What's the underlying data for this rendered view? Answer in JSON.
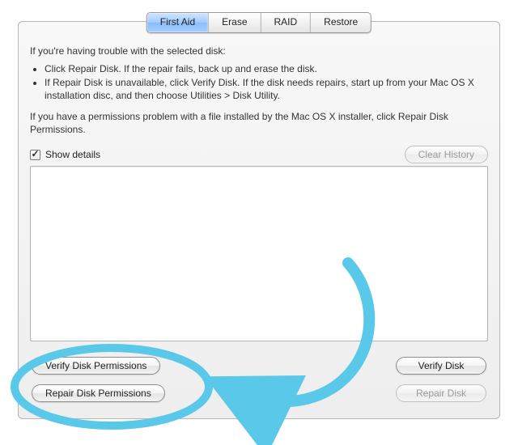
{
  "tabs": {
    "first_aid": "First Aid",
    "erase": "Erase",
    "raid": "RAID",
    "restore": "Restore"
  },
  "intro": {
    "line1": "If you're having trouble with the selected disk:",
    "bullet1": "Click Repair Disk. If the repair fails, back up and erase the disk.",
    "bullet2": "If Repair Disk is unavailable, click Verify Disk. If the disk needs repairs, start up from your Mac OS X installation disc, and then choose Utilities > Disk Utility.",
    "line2": "If you have a permissions problem with a file installed by the Mac OS X installer, click Repair Disk Permissions."
  },
  "details": {
    "show_label": "Show details",
    "clear_history": "Clear History"
  },
  "buttons": {
    "verify_perm": "Verify Disk Permissions",
    "repair_perm": "Repair Disk Permissions",
    "verify_disk": "Verify Disk",
    "repair_disk": "Repair Disk"
  },
  "annotation": {
    "color": "#5ac8e8"
  }
}
